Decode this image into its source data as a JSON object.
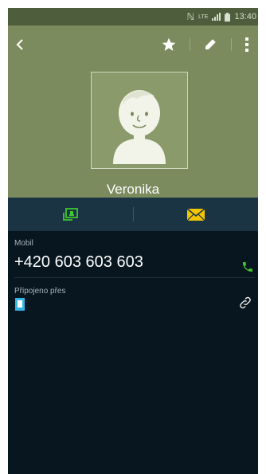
{
  "status_bar": {
    "nfc_glyph": "ℕ",
    "network_type": "LTE",
    "time": "13:40"
  },
  "contact": {
    "name": "Veronika"
  },
  "fields": [
    {
      "label": "Mobil",
      "value": "+420 603 603 603"
    },
    {
      "label": "Připojeno přes"
    }
  ],
  "icons": {
    "back": "chevron-left-icon",
    "star": "star-icon",
    "edit": "pencil-icon",
    "more": "more-vertical-icon",
    "contact_card": "contact-card-icon",
    "message": "envelope-icon",
    "call": "phone-icon",
    "linked_account": "phone-device-icon",
    "link": "link-icon"
  },
  "colors": {
    "header_bg": "#7b8b5d",
    "status_bar_bg": "#4e5d3b",
    "action_bar_bg": "#1a3444",
    "content_bg": "#07161f",
    "accent_green": "#3fc630",
    "accent_yellow": "#f2c500",
    "linked_blue": "#35b5e5"
  }
}
